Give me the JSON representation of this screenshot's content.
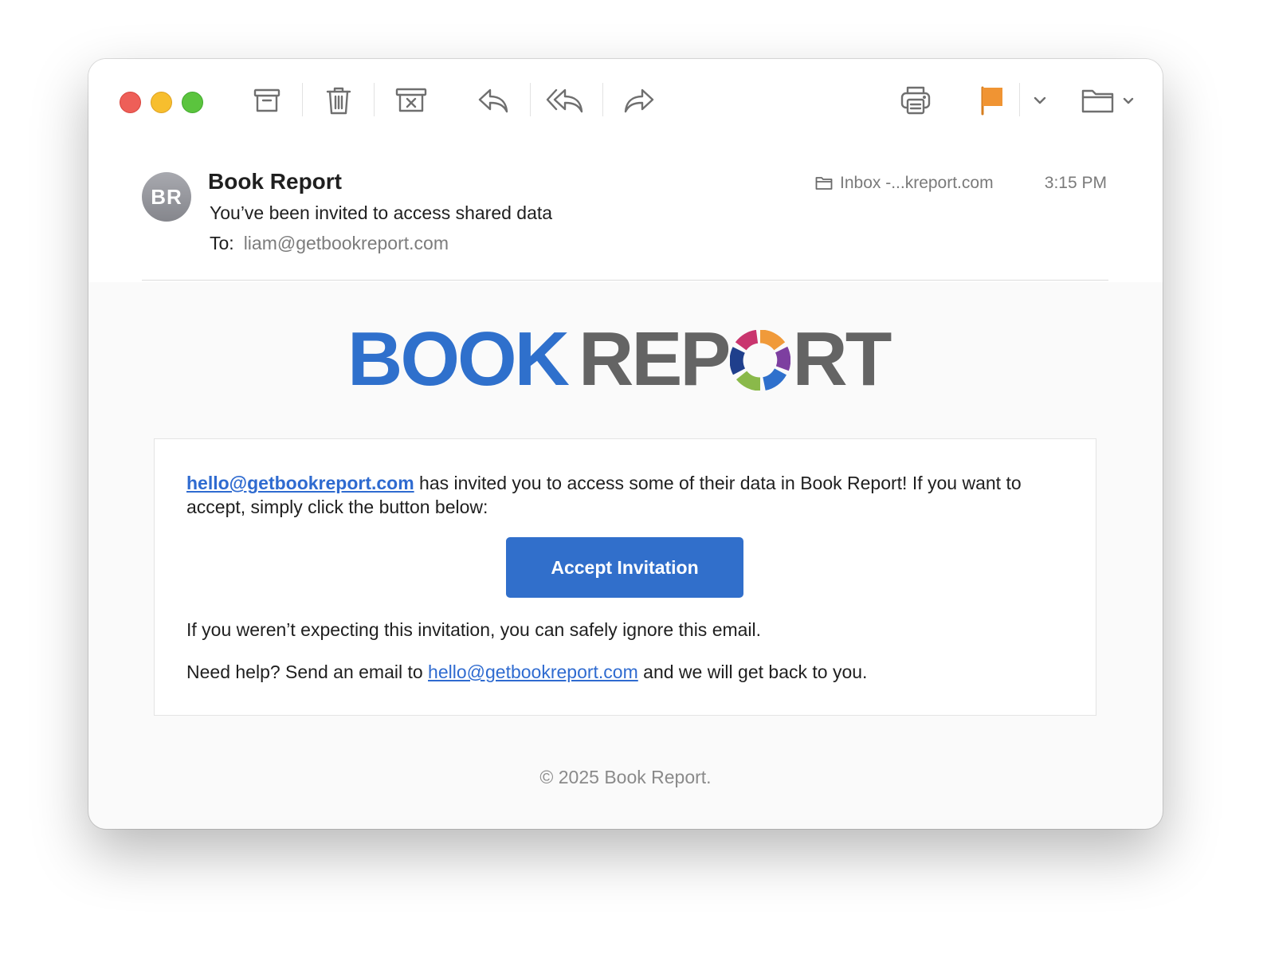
{
  "toolbar": {
    "icons": [
      "archive-icon",
      "trash-icon",
      "junk-icon",
      "reply-icon",
      "reply-all-icon",
      "forward-icon",
      "print-icon",
      "flag-icon",
      "chevron-down-icon",
      "move-to-folder-icon"
    ],
    "flag_color": "#f09433"
  },
  "header": {
    "avatar_initials": "BR",
    "sender": "Book Report",
    "subject": "You’ve been invited to access shared data",
    "to_label": "To:",
    "to_address": "liam@getbookreport.com",
    "mailbox": "Inbox -...kreport.com",
    "time": "3:15 PM"
  },
  "email": {
    "logo_word1": "BOOK",
    "logo_word2_start": "REP",
    "logo_word2_end": "RT",
    "logo_colors": {
      "book": "#2f70cc",
      "report": "#646464"
    },
    "inviter_link": "hello@getbookreport.com",
    "invite_text": " has invited you to access some of their data in Book Report! If you want to accept, simply click the button below:",
    "accept_button": "Accept Invitation",
    "ignore_text": "If you weren’t expecting this invitation, you can safely ignore this email.",
    "help_prefix": "Need help? Send an email to ",
    "help_link": "hello@getbookreport.com",
    "help_suffix": " and we will get back to you.",
    "footer": "© 2025 Book Report."
  }
}
